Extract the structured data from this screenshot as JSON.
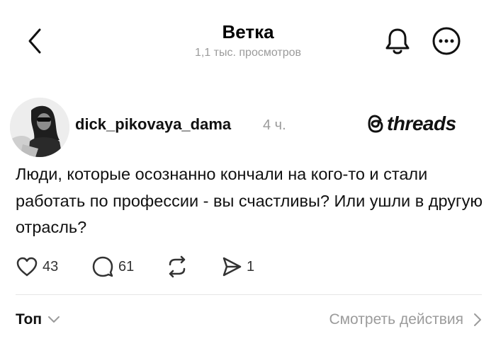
{
  "header": {
    "title": "Ветка",
    "views": "1,1 тыс. просмотров",
    "icons": {
      "back": "chevron-left-icon",
      "bell": "bell-icon",
      "more": "more-horizontal-icon"
    }
  },
  "post": {
    "username": "dick_pikovaya_dama",
    "time": "4 ч.",
    "brand": "threads",
    "text": "Люди, которые осознанно кончали на кого-то и стали работать по профессии - вы счастливы? Или ушли в другую отрасль?",
    "likes": "43",
    "replies": "61",
    "shares": "1",
    "icons": {
      "like": "heart-icon",
      "reply": "comment-icon",
      "repost": "repost-icon",
      "share": "send-icon"
    }
  },
  "footer": {
    "sort_label": "Топ",
    "view_actions_label": "Смотреть действия"
  },
  "colors": {
    "text": "#111111",
    "muted": "#9b9b9b",
    "divider": "#e6e6e6",
    "background": "#ffffff"
  }
}
